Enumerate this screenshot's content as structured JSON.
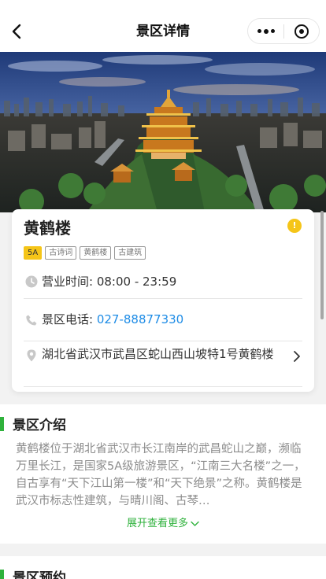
{
  "navbar": {
    "title": "景区详情"
  },
  "hero": {
    "image_desc": "黄鹤楼鸟瞰夜景"
  },
  "spot": {
    "name": "黄鹤楼",
    "tags": [
      "5A",
      "古诗词",
      "黄鹤楼",
      "古建筑"
    ],
    "hours_label": "营业时间: ",
    "hours_value": "08:00 - 23:59",
    "phone_label": "景区电话: ",
    "phone_value": "027-88877330",
    "address": "湖北省武汉市武昌区蛇山西山坡特1号黄鹤楼"
  },
  "intro": {
    "heading": "景区介绍",
    "text": "黄鹤楼位于湖北省武汉市长江南岸的武昌蛇山之巅，濒临万里长江，是国家5A级旅游景区，“江南三大名楼”之一，自古享有“天下江山第一楼”和“天下绝景”之称。黄鹤楼是武汉市标志性建筑，与晴川阁、古琴…",
    "expand_label": "展开查看更多"
  },
  "booking": {
    "heading": "景区预约"
  },
  "colors": {
    "accent_green": "#2fb23c",
    "link_blue": "#1e8ce6",
    "badge_yellow": "#f5c518"
  }
}
